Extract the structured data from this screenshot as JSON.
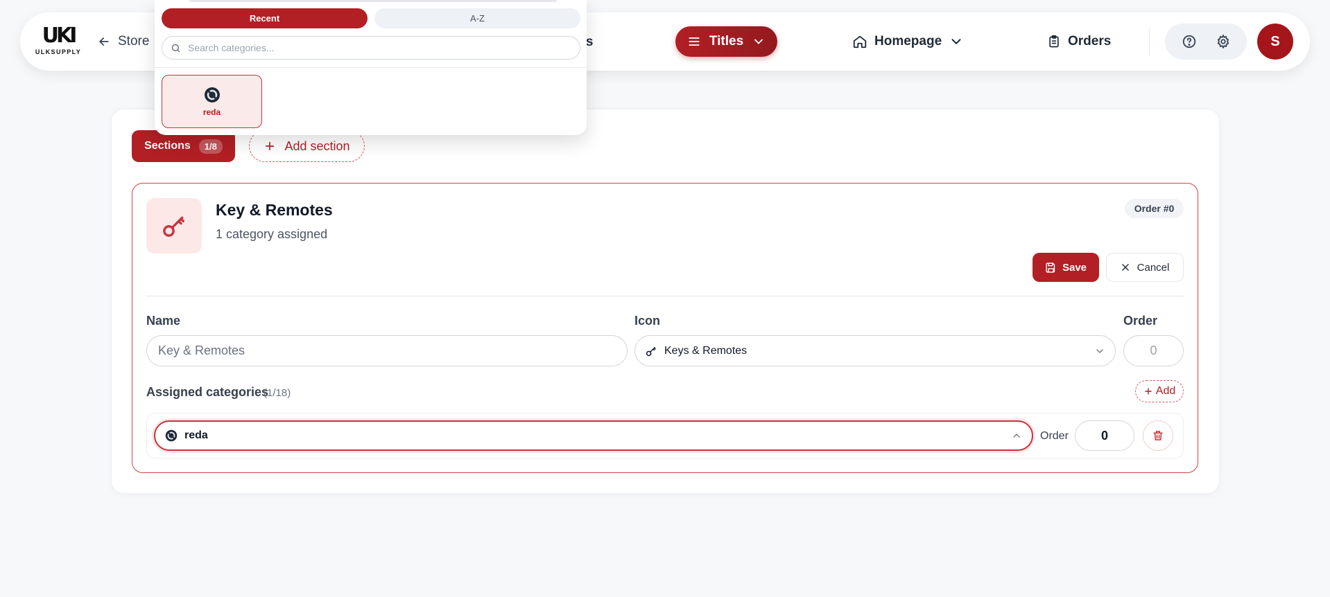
{
  "nav": {
    "logo_text": "ULKSUPPLY",
    "back_label": "Store",
    "products_partial": "cts",
    "titles_label": "Titles",
    "homepage_label": "Homepage",
    "orders_label": "Orders",
    "avatar_initial": "S",
    "icons": [
      "arrow-left-icon",
      "menu-icon",
      "chevron-down-icon",
      "home-icon",
      "clipboard-icon",
      "help-icon",
      "gear-icon"
    ]
  },
  "dropdown": {
    "tabs": [
      {
        "label": "Recent",
        "active": true
      },
      {
        "label": "A-Z",
        "active": false
      }
    ],
    "search_placeholder": "Search categories...",
    "items": [
      {
        "label": "reda",
        "selected": true
      }
    ]
  },
  "toolbar": {
    "sections_label": "Sections",
    "sections_count": "1/8",
    "add_section_label": "Add section"
  },
  "section": {
    "title": "Key & Remotes",
    "subtitle": "1 category assigned",
    "order_badge": "Order #0",
    "save_label": "Save",
    "cancel_label": "Cancel",
    "name_label": "Name",
    "name_value": "Key & Remotes",
    "icon_label": "Icon",
    "icon_value": "Keys & Remotes",
    "order_label": "Order",
    "order_placeholder": "0",
    "assigned_label": "Assigned categories",
    "assigned_count": "(1/18)",
    "add_label": "Add",
    "assigned_rows": [
      {
        "category": "reda",
        "order_label": "Order",
        "order_value": "0"
      }
    ]
  },
  "colors": {
    "accent": "#b21f24",
    "accent_light": "#fde8e8",
    "background": "#f7f8fa"
  }
}
